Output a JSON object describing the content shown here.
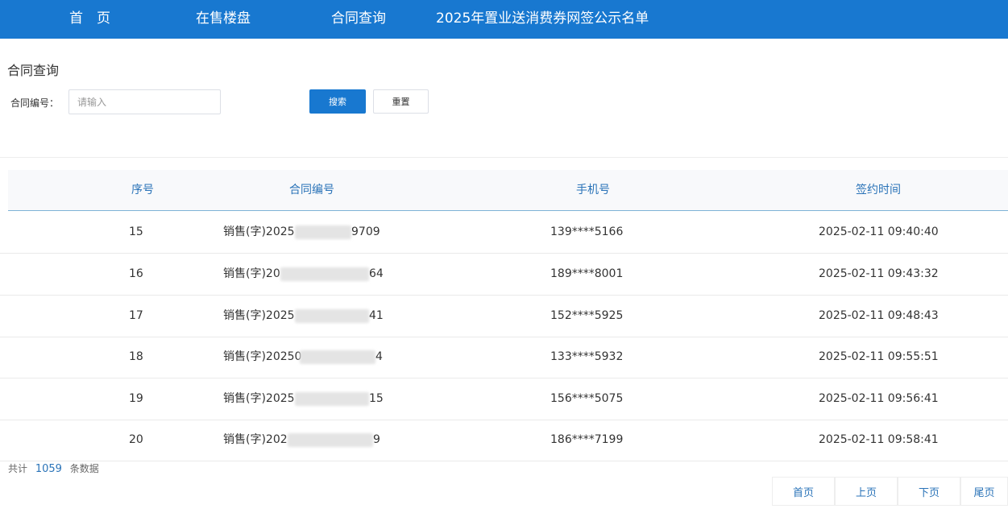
{
  "nav": {
    "home": "首　页",
    "on_sale": "在售楼盘",
    "contract_query": "合同查询",
    "coupon_list": "2025年置业送消费券网签公示名单"
  },
  "search": {
    "section_title": "合同查询",
    "label": "合同编号：",
    "placeholder": "请输入",
    "value": "",
    "search_button": "搜索",
    "reset_button": "重置"
  },
  "table": {
    "headers": {
      "index": "序号",
      "contract": "合同编号",
      "phone": "手机号",
      "signed_at": "签约时间"
    },
    "rows": [
      {
        "index": "15",
        "contract_prefix": "销售(字)2025",
        "contract_suffix": "9709",
        "phone": "139****5166",
        "signed_at": "2025-02-11 09:40:40"
      },
      {
        "index": "16",
        "contract_prefix": "销售(字)20",
        "contract_suffix": "64",
        "phone": "189****8001",
        "signed_at": "2025-02-11 09:43:32"
      },
      {
        "index": "17",
        "contract_prefix": "销售(字)2025",
        "contract_suffix": "41",
        "phone": "152****5925",
        "signed_at": "2025-02-11 09:48:43"
      },
      {
        "index": "18",
        "contract_prefix": "销售(字)20250",
        "contract_suffix": "4",
        "phone": "133****5932",
        "signed_at": "2025-02-11 09:55:51"
      },
      {
        "index": "19",
        "contract_prefix": "销售(字)2025",
        "contract_suffix": "15",
        "phone": "156****5075",
        "signed_at": "2025-02-11 09:56:41"
      },
      {
        "index": "20",
        "contract_prefix": "销售(字)202",
        "contract_suffix": "9",
        "phone": "186****7199",
        "signed_at": "2025-02-11 09:58:41"
      }
    ]
  },
  "footer": {
    "total_prefix": "共计",
    "total_count": "1059",
    "total_suffix": "条数据"
  },
  "pagination": {
    "first": "首页",
    "prev": "上页",
    "next": "下页",
    "last": "尾页"
  },
  "colors": {
    "brand": "#1878d0",
    "link": "#2a73b8"
  }
}
